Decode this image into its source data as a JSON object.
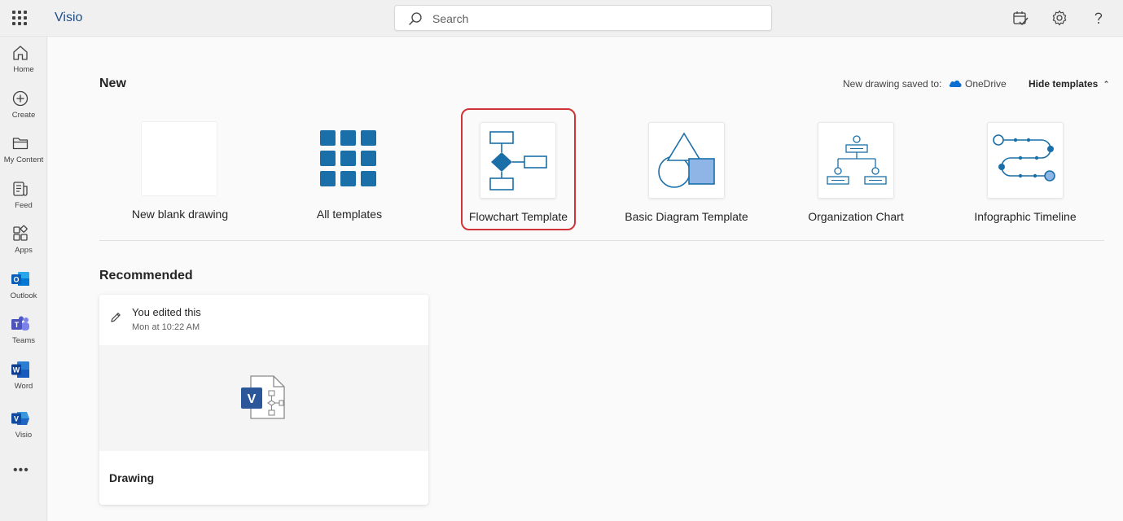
{
  "header": {
    "app_name": "Visio",
    "search_placeholder": "Search"
  },
  "rail": {
    "items": [
      {
        "label": "Home",
        "icon": "home-icon"
      },
      {
        "label": "Create",
        "icon": "plus-circle-icon"
      },
      {
        "label": "My Content",
        "icon": "folder-icon"
      },
      {
        "label": "Feed",
        "icon": "feed-icon"
      },
      {
        "label": "Apps",
        "icon": "apps-icon"
      },
      {
        "label": "Outlook",
        "icon": "outlook-icon"
      },
      {
        "label": "Teams",
        "icon": "teams-icon"
      },
      {
        "label": "Word",
        "icon": "word-icon"
      },
      {
        "label": "Visio",
        "icon": "visio-icon"
      }
    ],
    "more_icon": "more-icon"
  },
  "new_section": {
    "title": "New",
    "saved_to_label": "New drawing saved to:",
    "saved_to_location": "OneDrive",
    "hide_templates_label": "Hide templates",
    "templates": [
      {
        "label": "New blank drawing"
      },
      {
        "label": "All templates"
      },
      {
        "label": "Flowchart Template",
        "selected": true
      },
      {
        "label": "Basic Diagram Template"
      },
      {
        "label": "Organization Chart"
      },
      {
        "label": "Infographic Timeline"
      }
    ]
  },
  "recommended": {
    "title": "Recommended",
    "card": {
      "activity": "You edited this",
      "time": "Mon at 10:22 AM",
      "name": "Drawing"
    }
  },
  "colors": {
    "accent": "#1e4e8c",
    "template_blue": "#1b6fa8",
    "selection_red": "#d13438"
  }
}
